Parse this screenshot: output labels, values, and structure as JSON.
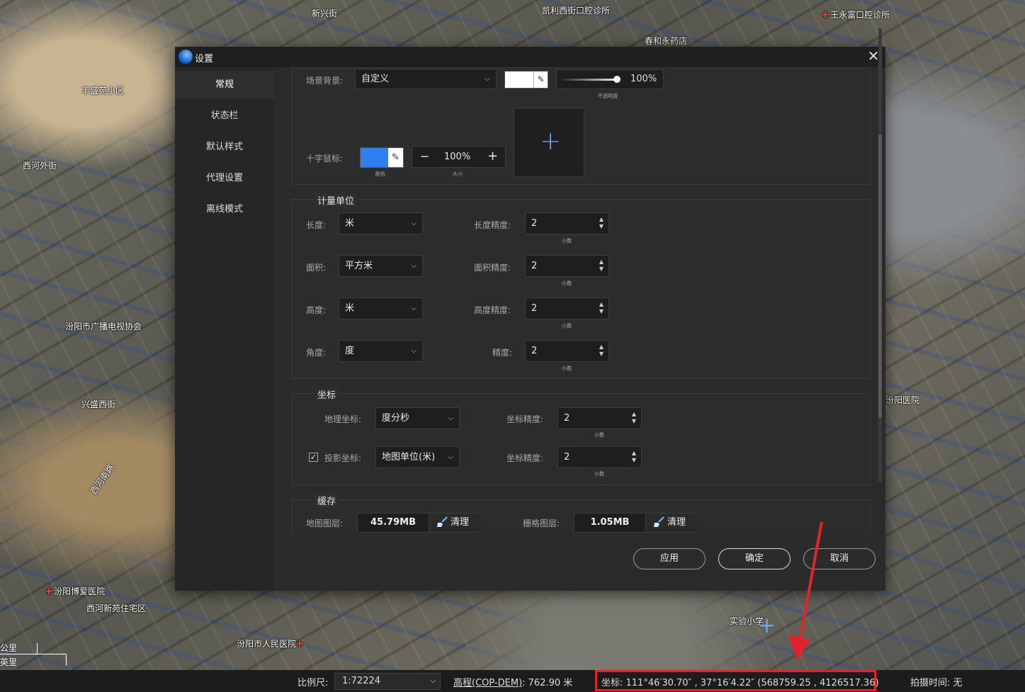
{
  "map": {
    "labels": [
      {
        "text": "凯利西街口腔诊所",
        "pin": false
      },
      {
        "text": "王永富口腔诊所",
        "pin": true
      },
      {
        "text": "春和永药店",
        "pin": false
      },
      {
        "text": "新兴街",
        "pin": false
      },
      {
        "text": "丰盛苑小区",
        "pin": false
      },
      {
        "text": "西河外街",
        "pin": false
      },
      {
        "text": "汾阳市广播电视协会",
        "pin": false
      },
      {
        "text": "兴盛西街",
        "pin": false
      },
      {
        "text": "西河南路",
        "pin": false
      },
      {
        "text": "汾阳博爱医院",
        "pin": true
      },
      {
        "text": "西河新苑住宅区",
        "pin": false
      },
      {
        "text": "汾阳市人民医院",
        "pin": true
      },
      {
        "text": "实验小学",
        "pin": false
      },
      {
        "text": "汾阳医院",
        "pin": false
      }
    ],
    "scalebar": {
      "top": "公里",
      "bottom": "英里"
    }
  },
  "dialog": {
    "title": "设置",
    "close_icon": "✕",
    "nav": [
      {
        "label": "常规",
        "active": true
      },
      {
        "label": "状态栏",
        "active": false
      },
      {
        "label": "默认样式",
        "active": false
      },
      {
        "label": "代理设置",
        "active": false
      },
      {
        "label": "离线模式",
        "active": false
      }
    ],
    "scene": {
      "label": "场景背景:",
      "value": "自定义",
      "bg_color": "#ffffff",
      "opacity_value": "100%",
      "opacity_caption": "不透明度"
    },
    "crosshair": {
      "label": "十字鼠标:",
      "color": "#2f7ff0",
      "color_caption": "颜色",
      "size_value": "100%",
      "size_caption": "大小",
      "minus": "−",
      "plus": "+",
      "preview_icon": "+"
    },
    "units": {
      "title": "计量单位",
      "rows": [
        {
          "label": "长度:",
          "value": "米",
          "prec_label": "长度精度:",
          "prec_value": "2",
          "caption": "小数"
        },
        {
          "label": "面积:",
          "value": "平方米",
          "prec_label": "面积精度:",
          "prec_value": "2",
          "caption": "小数"
        },
        {
          "label": "高度:",
          "value": "米",
          "prec_label": "高度精度:",
          "prec_value": "2",
          "caption": "小数"
        },
        {
          "label": "角度:",
          "value": "度",
          "prec_label": "精度:",
          "prec_value": "2",
          "caption": "小数"
        }
      ]
    },
    "coords": {
      "title": "坐标",
      "geo_label": "地理坐标:",
      "geo_value": "度分秒",
      "geo_prec_label": "坐标精度:",
      "geo_prec_value": "2",
      "geo_caption": "小数",
      "proj_checked": true,
      "proj_label": "投影坐标:",
      "proj_value": "地图单位(米)",
      "proj_prec_label": "坐标精度:",
      "proj_prec_value": "2",
      "proj_caption": "小数"
    },
    "cache": {
      "title": "缓存",
      "map_label": "地图图层:",
      "map_size": "45.79MB",
      "map_clear": "清理",
      "raster_label": "栅格图层:",
      "raster_size": "1.05MB",
      "raster_clear": "清理"
    },
    "buttons": {
      "apply": "应用",
      "ok": "确定",
      "cancel": "取消"
    }
  },
  "statusbar": {
    "scale_label": "比例尺:",
    "scale_value": "1:72224",
    "elev_label": "高程(COP-DEM)",
    "elev_value": ": 762.90 米",
    "coord_text": "坐标: 111°46′30.70″ , 37°16′4.22″   (568759.25 , 4126517.36)",
    "time_text": "拍摄时间: 无",
    "highlight_color": "#e0242a"
  }
}
